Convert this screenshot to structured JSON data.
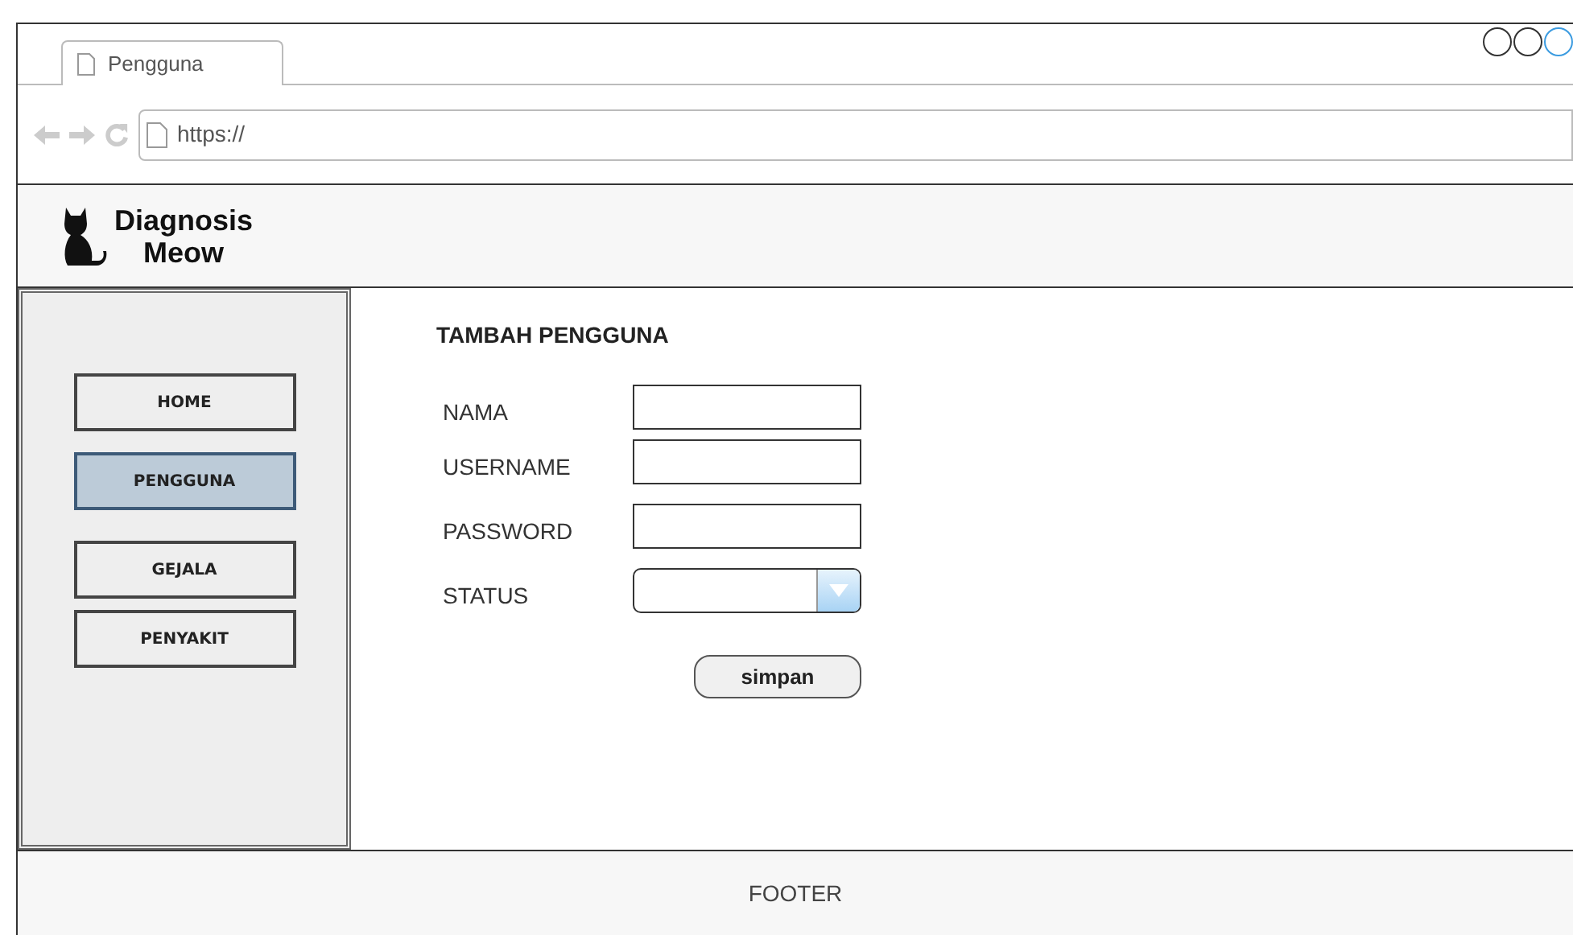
{
  "browser": {
    "tab_title": "Pengguna",
    "url": "https://"
  },
  "header": {
    "logo_line_1": "Diagnosis",
    "logo_line_2": "Meow"
  },
  "sidebar": {
    "items": [
      {
        "label": "HOME",
        "selected": false
      },
      {
        "label": "PENGGUNA",
        "selected": true
      },
      {
        "label": "GEJALA",
        "selected": false
      },
      {
        "label": "PENYAKIT",
        "selected": false
      }
    ]
  },
  "form": {
    "title": "TAMBAH PENGGUNA",
    "fields": [
      {
        "label": "NAMA",
        "kind": "text"
      },
      {
        "label": "USERNAME",
        "kind": "text"
      },
      {
        "label": "PASSWORD",
        "kind": "text"
      },
      {
        "label": "STATUS",
        "kind": "select"
      }
    ],
    "submit": "simpan"
  },
  "footer": "FOOTER"
}
